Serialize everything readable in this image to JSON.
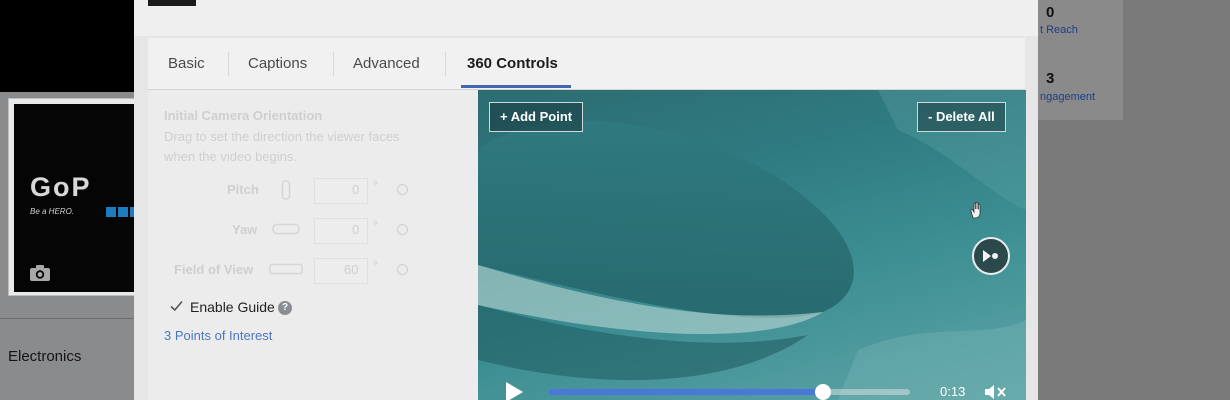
{
  "background": {
    "brand_logo": "GoP",
    "brand_tagline": "Be a HERO.",
    "category": "Electronics",
    "stats": [
      {
        "value": "0",
        "label": "t Reach"
      },
      {
        "value": "3",
        "label": "ngagement"
      }
    ]
  },
  "tabs": [
    {
      "label": "Basic",
      "active": false
    },
    {
      "label": "Captions",
      "active": false
    },
    {
      "label": "Advanced",
      "active": false
    },
    {
      "label": "360 Controls",
      "active": true
    }
  ],
  "orientation": {
    "title": "Initial Camera Orientation",
    "description_line1": "Drag to set the direction the viewer faces",
    "description_line2": "when the video begins.",
    "fields": [
      {
        "label": "Pitch",
        "value": "0",
        "unit": "°"
      },
      {
        "label": "Yaw",
        "value": "0",
        "unit": "°"
      },
      {
        "label": "Field of View",
        "value": "60",
        "unit": "°"
      }
    ]
  },
  "guide": {
    "enable_label": "Enable Guide",
    "checked": true,
    "help_icon": "?",
    "points_link": "3 Points of Interest"
  },
  "video": {
    "add_point_label": "+ Add Point",
    "delete_all_label": "- Delete All",
    "time": "0:13",
    "progress": 0.76,
    "icons": [
      "hand-icon",
      "compass-icon",
      "play-icon",
      "mute-icon"
    ]
  },
  "colors": {
    "accent": "#4266b2",
    "link": "#4a78c2",
    "progress": "#4a78d6"
  }
}
